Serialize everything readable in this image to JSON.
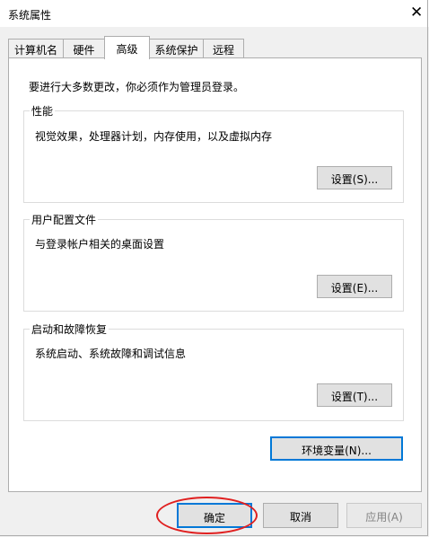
{
  "window": {
    "title": "系统属性",
    "close_glyph": "✕"
  },
  "tabs": [
    {
      "label": "计算机名",
      "active": false
    },
    {
      "label": "硬件",
      "active": false
    },
    {
      "label": "高级",
      "active": true
    },
    {
      "label": "系统保护",
      "active": false
    },
    {
      "label": "远程",
      "active": false
    }
  ],
  "advanced": {
    "admin_note": "要进行大多数更改，你必须作为管理员登录。",
    "performance": {
      "title": "性能",
      "description": "视觉效果，处理器计划，内存使用，以及虚拟内存",
      "button": "设置(S)..."
    },
    "user_profiles": {
      "title": "用户配置文件",
      "description": "与登录帐户相关的桌面设置",
      "button": "设置(E)..."
    },
    "startup_recovery": {
      "title": "启动和故障恢复",
      "description": "系统启动、系统故障和调试信息",
      "button": "设置(T)..."
    },
    "env_vars_button": "环境变量(N)..."
  },
  "footer": {
    "ok": "确定",
    "cancel": "取消",
    "apply": "应用(A)"
  },
  "colors": {
    "focus": "#0078d7",
    "annotation": "#e02020"
  }
}
